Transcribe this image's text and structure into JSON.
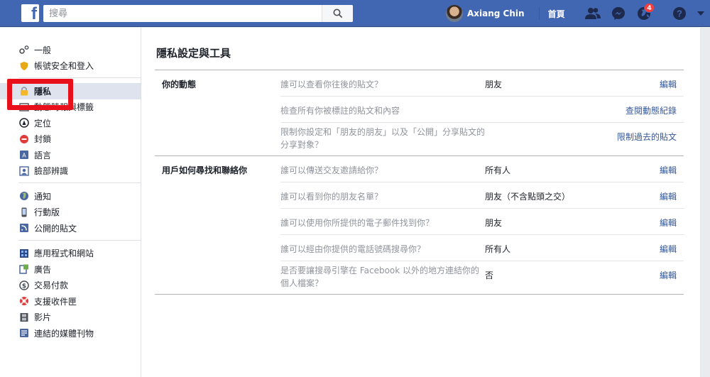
{
  "topbar": {
    "search_placeholder": "搜尋",
    "user_name": "Axiang Chin",
    "home_label": "首頁",
    "notification_count": "4"
  },
  "sidebar": {
    "groups": [
      [
        {
          "label": "一般",
          "icon": "gears-icon"
        },
        {
          "label": "帳號安全和登入",
          "icon": "shield-icon"
        }
      ],
      [
        {
          "label": "隱私",
          "icon": "lock-icon",
          "active": true
        },
        {
          "label": "動態時報與標籤",
          "icon": "timeline-icon"
        },
        {
          "label": "定位",
          "icon": "location-icon"
        },
        {
          "label": "封鎖",
          "icon": "block-icon"
        },
        {
          "label": "語言",
          "icon": "language-icon"
        },
        {
          "label": "臉部辨識",
          "icon": "face-recognition-icon"
        }
      ],
      [
        {
          "label": "通知",
          "icon": "globe-icon"
        },
        {
          "label": "行動版",
          "icon": "mobile-icon"
        },
        {
          "label": "公開的貼文",
          "icon": "rss-icon"
        }
      ],
      [
        {
          "label": "應用程式和網站",
          "icon": "apps-icon"
        },
        {
          "label": "廣告",
          "icon": "ads-icon"
        },
        {
          "label": "交易付款",
          "icon": "payments-icon"
        },
        {
          "label": "支援收件匣",
          "icon": "lifebuoy-icon"
        },
        {
          "label": "影片",
          "icon": "film-icon"
        },
        {
          "label": "連結的媒體刊物",
          "icon": "media-icon"
        }
      ]
    ]
  },
  "main": {
    "title": "隱私設定與工具",
    "sections": [
      {
        "title": "你的動態",
        "rows": [
          {
            "question": "誰可以查看你往後的貼文？",
            "value": "朋友",
            "action": "編輯"
          },
          {
            "question": "檢查所有你被標註的貼文和內容",
            "value": "",
            "action": "查閱動態紀錄"
          },
          {
            "question": "限制你設定和「朋友的朋友」以及「公開」分享貼文的分享對象？",
            "value": "",
            "action": "限制過去的貼文",
            "tall": true
          }
        ]
      },
      {
        "title": "用戶如何尋找和聯絡你",
        "rows": [
          {
            "question": "誰可以傳送交友邀請給你？",
            "value": "所有人",
            "action": "編輯"
          },
          {
            "question": "誰可以看到你的朋友名單？",
            "value": "朋友（不含點頭之交）",
            "action": "編輯"
          },
          {
            "question": "誰可以使用你所提供的電子郵件找到你？",
            "value": "朋友",
            "action": "編輯"
          },
          {
            "question": "誰可以經由你提供的電話號碼搜尋你？",
            "value": "所有人",
            "action": "編輯"
          },
          {
            "question": "是否要讓搜尋引擎在 Facebook 以外的地方連結你的個人檔案？",
            "value": "否",
            "action": "編輯",
            "tall": true
          }
        ]
      }
    ]
  },
  "colors": {
    "brand": "#4267b2",
    "link": "#365899",
    "highlight_box": "#e8101a",
    "badge": "#fa3e3e"
  }
}
